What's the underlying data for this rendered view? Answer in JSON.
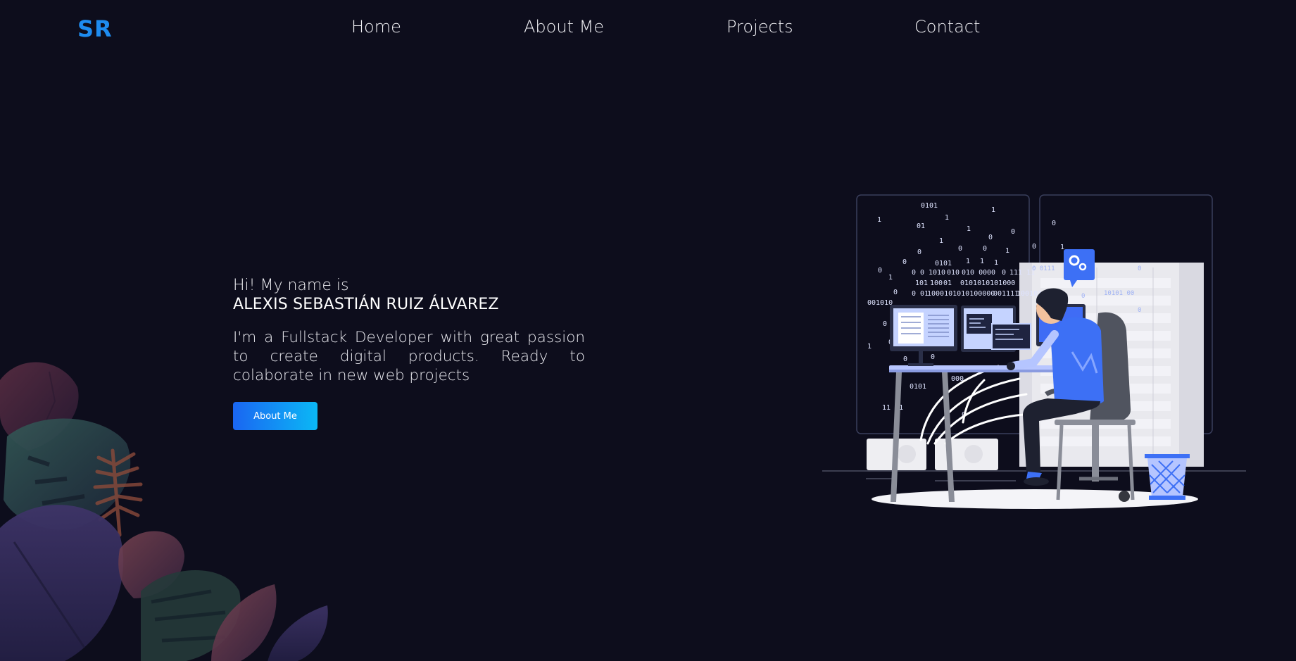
{
  "header": {
    "logo": "SR",
    "nav": [
      {
        "label": "Home"
      },
      {
        "label": "About Me"
      },
      {
        "label": "Projects"
      },
      {
        "label": "Contact"
      }
    ]
  },
  "hero": {
    "greeting": "Hi! My name is",
    "name": "ALEXIS SEBASTIÁN RUIZ ÁLVAREZ",
    "description": "I'm a Fullstack Developer with great passion to create digital products. Ready to colaborate in new web projects",
    "cta_label": "About Me"
  },
  "colors": {
    "background": "#0d0d1c",
    "accent": "#1e8cf0",
    "button_gradient_start": "#1a66f2",
    "button_gradient_end": "#0bb8f5"
  },
  "illustration": {
    "binary_rows": [
      "0101",
      "1",
      "1",
      "1",
      "01",
      "1",
      "0",
      "1",
      "0",
      "0",
      "0",
      "1",
      "0",
      "0",
      "0101",
      "1",
      "1",
      "1",
      "0",
      "0 0",
      "1010",
      "010",
      "010 0",
      "000",
      "0",
      "111 11",
      "101",
      "100",
      "01",
      "0101010101000",
      "0",
      "0 01",
      "1000101010100000",
      "001111",
      "100101",
      "001010",
      "0",
      "1",
      "0",
      "0",
      "0",
      "0101",
      "000",
      "0",
      "11 01",
      "0"
    ],
    "right_panel_digits": [
      "0",
      "1",
      "0 0111",
      "0",
      "10101 00",
      "0",
      "0"
    ]
  }
}
